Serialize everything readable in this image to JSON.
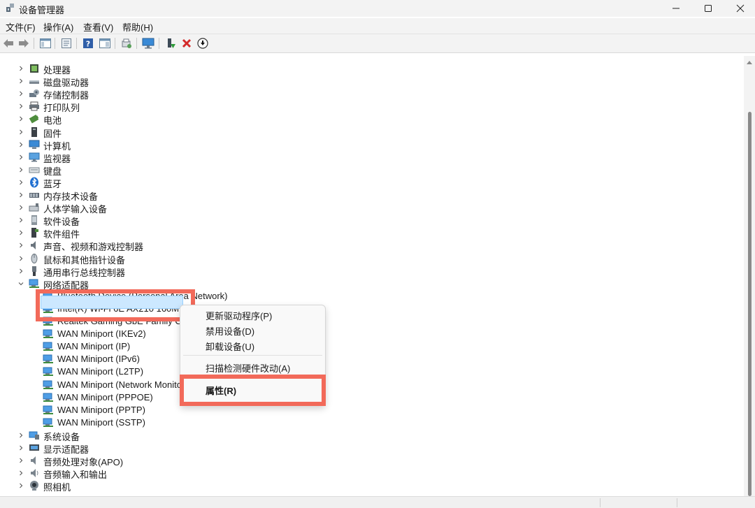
{
  "window": {
    "title": "设备管理器"
  },
  "menubar": [
    "文件(F)",
    "操作(A)",
    "查看(V)",
    "帮助(H)"
  ],
  "toolbar": {
    "icons": [
      "back-icon",
      "forward-icon",
      "show-hide-console-tree-icon",
      "properties-icon",
      "help-icon",
      "action-pane-icon",
      "scan-hardware-icon",
      "monitor-icon",
      "enable-device-icon",
      "uninstall-icon",
      "update-driver-icon"
    ]
  },
  "tree": {
    "categories_top": [
      {
        "label": "处理器",
        "icon": "cpu-icon"
      },
      {
        "label": "磁盘驱动器",
        "icon": "disk-icon"
      },
      {
        "label": "存储控制器",
        "icon": "storage-controller-icon"
      },
      {
        "label": "打印队列",
        "icon": "printer-icon"
      },
      {
        "label": "电池",
        "icon": "battery-icon"
      },
      {
        "label": "固件",
        "icon": "firmware-icon"
      },
      {
        "label": "计算机",
        "icon": "computer-icon"
      },
      {
        "label": "监视器",
        "icon": "monitor-icon"
      },
      {
        "label": "键盘",
        "icon": "keyboard-icon"
      },
      {
        "label": "蓝牙",
        "icon": "bluetooth-icon"
      },
      {
        "label": "内存技术设备",
        "icon": "memory-icon"
      },
      {
        "label": "人体学输入设备",
        "icon": "hid-icon"
      },
      {
        "label": "软件设备",
        "icon": "software-device-icon"
      },
      {
        "label": "软件组件",
        "icon": "software-component-icon"
      },
      {
        "label": "声音、视频和游戏控制器",
        "icon": "sound-icon"
      },
      {
        "label": "鼠标和其他指针设备",
        "icon": "mouse-icon"
      },
      {
        "label": "通用串行总线控制器",
        "icon": "usb-icon"
      }
    ],
    "network": {
      "label": "网络适配器",
      "children": [
        "Bluetooth Device (Personal Area Network)",
        "Intel(R) Wi-Fi 6E AX210 160MHz",
        "Realtek Gaming GbE Family C",
        "WAN Miniport (IKEv2)",
        "WAN Miniport (IP)",
        "WAN Miniport (IPv6)",
        "WAN Miniport (L2TP)",
        "WAN Miniport (Network Monitc",
        "WAN Miniport (PPPOE)",
        "WAN Miniport (PPTP)",
        "WAN Miniport (SSTP)"
      ]
    },
    "categories_bottom": [
      {
        "label": "系统设备",
        "icon": "system-device-icon"
      },
      {
        "label": "显示适配器",
        "icon": "display-adapter-icon"
      },
      {
        "label": "音频处理对象(APO)",
        "icon": "audio-apo-icon"
      },
      {
        "label": "音频输入和输出",
        "icon": "audio-io-icon"
      },
      {
        "label": "照相机",
        "icon": "camera-icon"
      }
    ]
  },
  "context_menu": {
    "items": [
      "更新驱动程序(P)",
      "禁用设备(D)",
      "卸载设备(U)",
      "扫描检测硬件改动(A)",
      "属性(R)"
    ]
  },
  "colors": {
    "selection": "#cce8ff",
    "highlight_frame": "#f26a5a"
  }
}
